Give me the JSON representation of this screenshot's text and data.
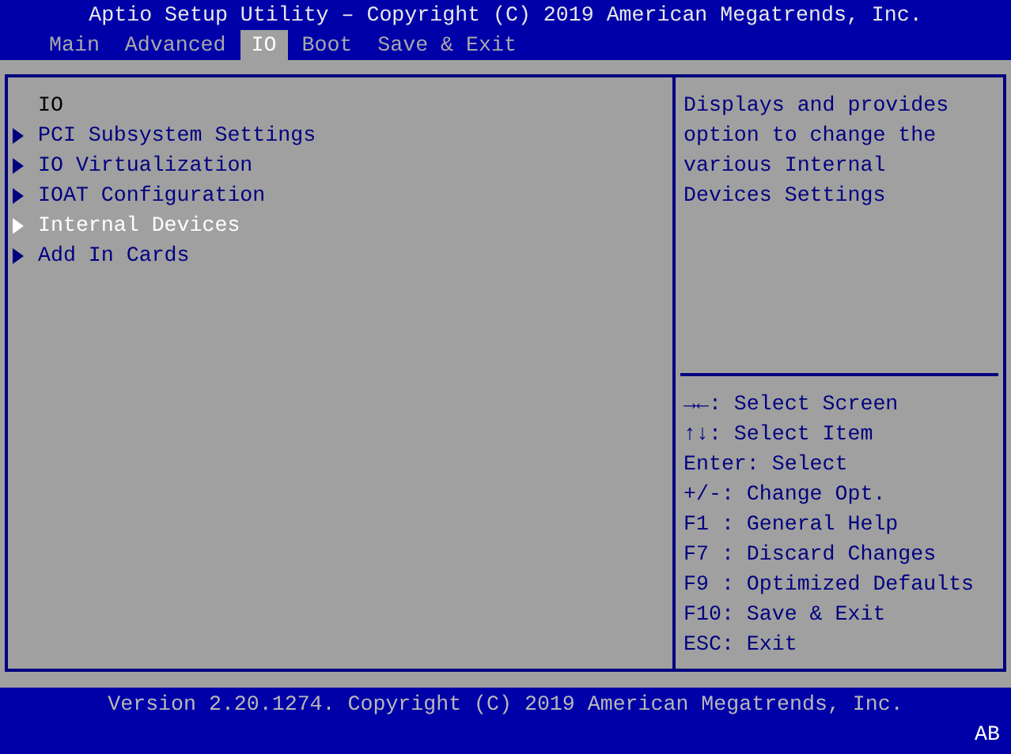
{
  "window": {
    "title": "Aptio Setup Utility – Copyright (C) 2019 American Megatrends, Inc."
  },
  "tabs": [
    {
      "label": "Main",
      "selected": false
    },
    {
      "label": "Advanced",
      "selected": false
    },
    {
      "label": "IO",
      "selected": true
    },
    {
      "label": "Boot",
      "selected": false
    },
    {
      "label": "Save & Exit",
      "selected": false
    }
  ],
  "menu": {
    "items": [
      {
        "kind": "header",
        "label": "IO",
        "selected": false
      },
      {
        "kind": "submenu",
        "label": "PCI Subsystem Settings",
        "selected": false
      },
      {
        "kind": "submenu",
        "label": "IO Virtualization",
        "selected": false
      },
      {
        "kind": "submenu",
        "label": "IOAT Configuration",
        "selected": false
      },
      {
        "kind": "submenu",
        "label": "Internal Devices",
        "selected": true
      },
      {
        "kind": "submenu",
        "label": "Add In Cards",
        "selected": false
      }
    ]
  },
  "help": {
    "description": "Displays and provides option to change the various Internal Devices Settings",
    "keys": [
      "→←: Select Screen",
      "↑↓: Select Item",
      "Enter: Select",
      "+/-: Change Opt.",
      "F1 : General Help",
      "F7 : Discard Changes",
      "F9 : Optimized Defaults",
      "F10: Save & Exit",
      "ESC: Exit"
    ]
  },
  "status_bar": {
    "version": "Version 2.20.1274. Copyright (C) 2019 American Megatrends, Inc.",
    "indicator": "AB"
  }
}
